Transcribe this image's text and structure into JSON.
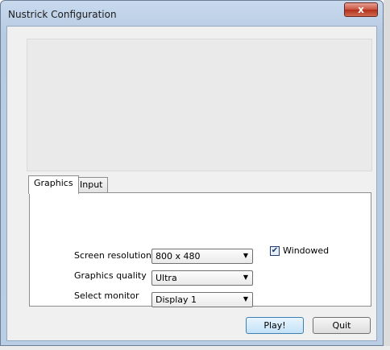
{
  "window": {
    "title": "Nustrick Configuration",
    "close_label": "x"
  },
  "tabs": [
    {
      "label": "Graphics",
      "active": true
    },
    {
      "label": "Input",
      "active": false
    }
  ],
  "settings": {
    "resolution": {
      "label": "Screen resolution",
      "value": "800 x 480"
    },
    "quality": {
      "label": "Graphics quality",
      "value": "Ultra"
    },
    "monitor": {
      "label": "Select monitor",
      "value": "Display 1"
    },
    "windowed": {
      "label": "Windowed",
      "checked": true
    }
  },
  "buttons": {
    "play": "Play!",
    "quit": "Quit"
  },
  "icons": {
    "close": "close-icon",
    "dropdown": "chevron-down-icon",
    "check": "checkmark-icon"
  },
  "colors": {
    "titlebar": "#c9daee",
    "close": "#c9533f",
    "client": "#f0f0f0"
  }
}
